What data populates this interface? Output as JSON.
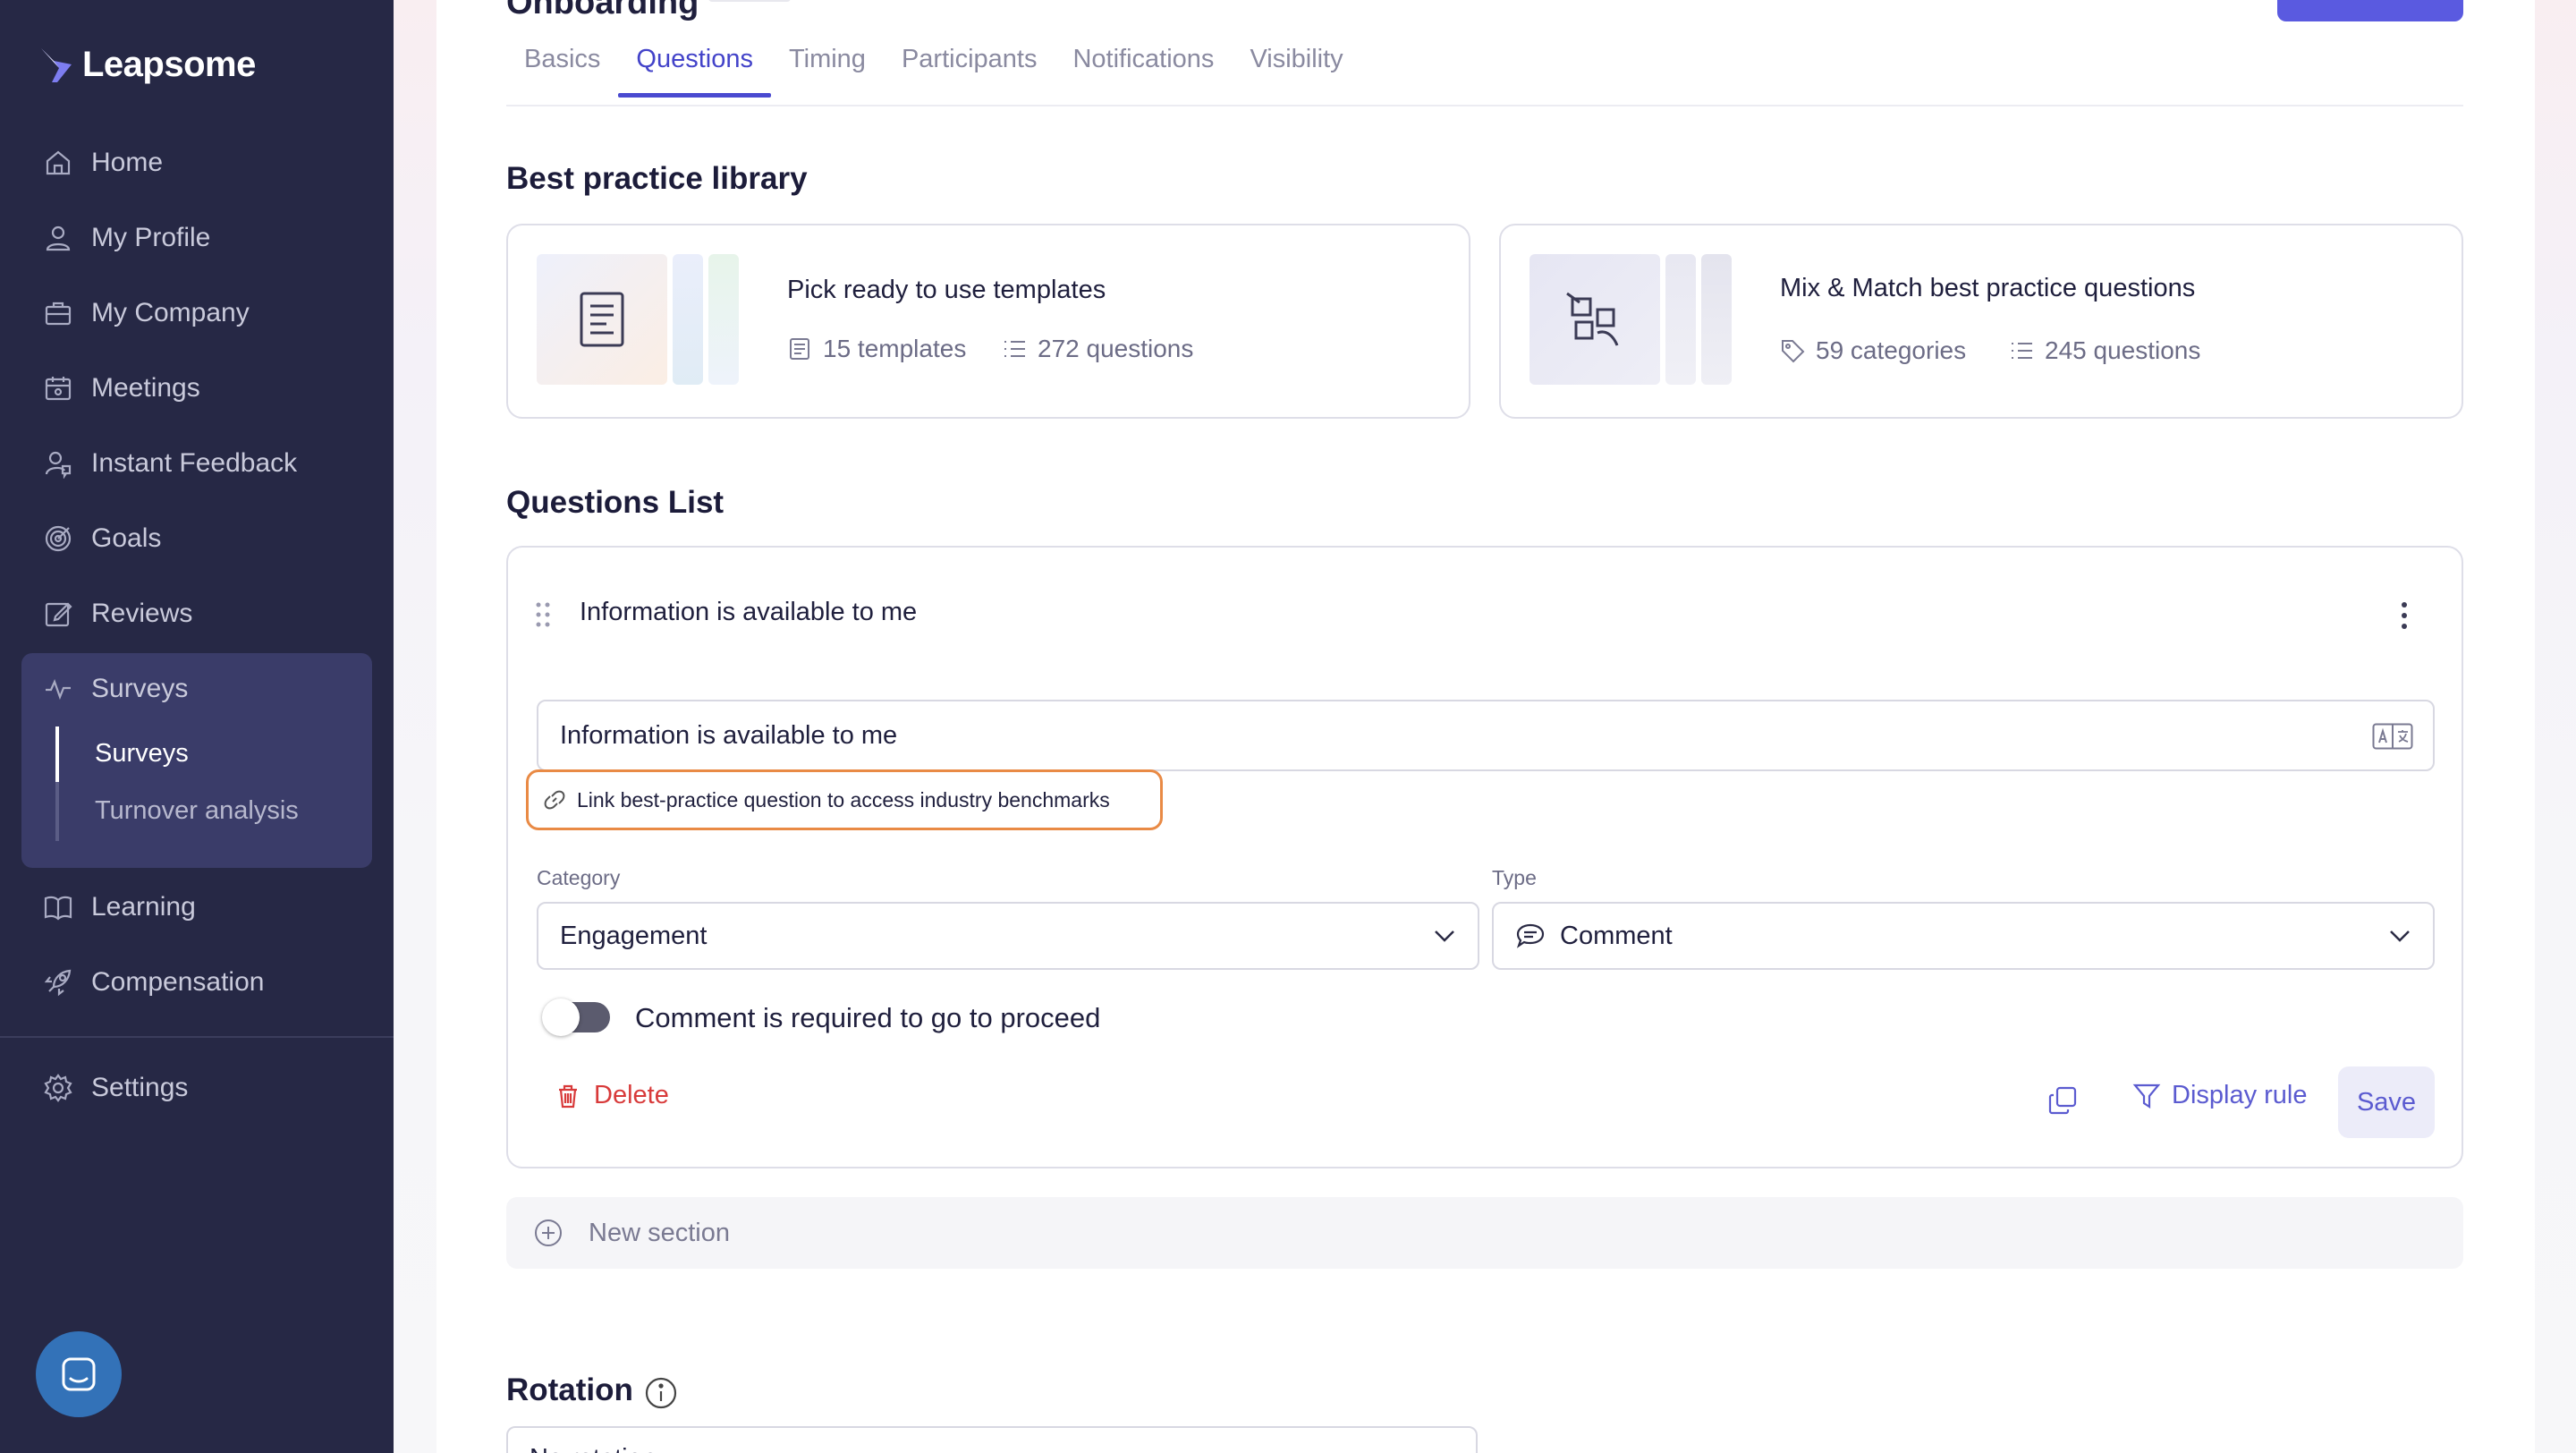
{
  "app": {
    "brand": "Leapsome"
  },
  "sidebar": {
    "items": [
      {
        "label": "Home",
        "icon": "home-icon"
      },
      {
        "label": "My Profile",
        "icon": "user-icon"
      },
      {
        "label": "My Company",
        "icon": "briefcase-icon"
      },
      {
        "label": "Meetings",
        "icon": "calendar-icon"
      },
      {
        "label": "Instant Feedback",
        "icon": "feedback-icon"
      },
      {
        "label": "Goals",
        "icon": "target-icon"
      },
      {
        "label": "Reviews",
        "icon": "edit-icon"
      },
      {
        "label": "Surveys",
        "icon": "pulse-icon"
      },
      {
        "label": "Learning",
        "icon": "book-icon"
      },
      {
        "label": "Compensation",
        "icon": "rocket-icon"
      },
      {
        "label": "Settings",
        "icon": "gear-icon"
      }
    ],
    "surveys_sub": [
      {
        "label": "Surveys",
        "active": true
      },
      {
        "label": "Turnover analysis",
        "active": false
      }
    ]
  },
  "header": {
    "title": "Onboarding"
  },
  "tabs": [
    {
      "label": "Basics",
      "active": false
    },
    {
      "label": "Questions",
      "active": true
    },
    {
      "label": "Timing",
      "active": false
    },
    {
      "label": "Participants",
      "active": false
    },
    {
      "label": "Notifications",
      "active": false
    },
    {
      "label": "Visibility",
      "active": false
    }
  ],
  "library": {
    "heading": "Best practice library",
    "cards": [
      {
        "title": "Pick ready to use templates",
        "meta1": "15 templates",
        "meta2": "272 questions"
      },
      {
        "title": "Mix & Match best practice questions",
        "meta1": "59 categories",
        "meta2": "245 questions"
      }
    ]
  },
  "questions": {
    "heading": "Questions List",
    "item": {
      "title": "Information is available to me",
      "input_value": "Information is available to me",
      "link_label": "Link best-practice question to access industry benchmarks",
      "category_label": "Category",
      "category_value": "Engagement",
      "type_label": "Type",
      "type_value": "Comment",
      "toggle_label": "Comment is required to go to proceed",
      "toggle_on": false,
      "delete_label": "Delete",
      "display_rule_label": "Display rule",
      "save_label": "Save"
    },
    "new_section_label": "New section"
  },
  "rotation": {
    "heading": "Rotation",
    "value": "No rotation"
  },
  "colors": {
    "sidebar_bg": "#262845",
    "accent": "#4a4ad0",
    "danger": "#d83a3a",
    "highlight": "#e98a45"
  }
}
